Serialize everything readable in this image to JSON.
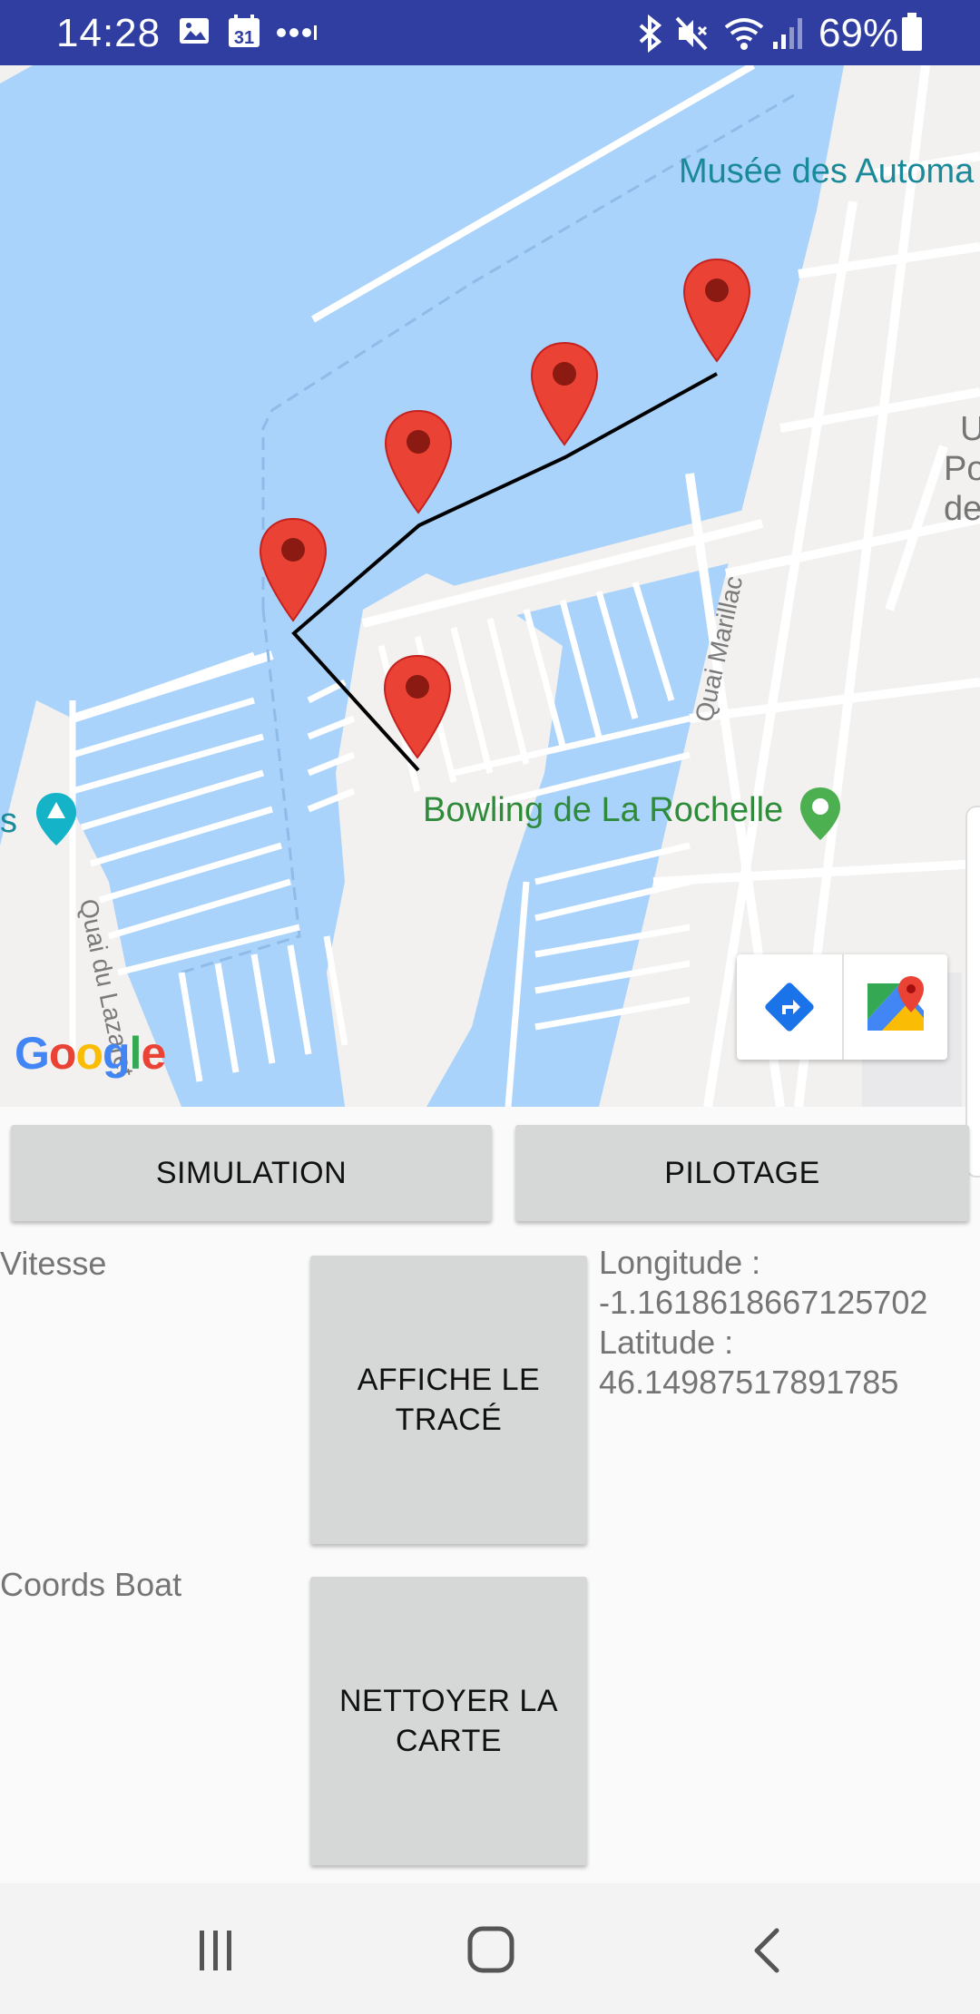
{
  "status_bar": {
    "time": "14:28",
    "calendar_day": "31",
    "battery": "69%",
    "icons": [
      "gallery-icon",
      "calendar-icon",
      "more-icon",
      "bluetooth-icon",
      "mute-icon",
      "wifi-icon",
      "signal-icon",
      "battery-icon"
    ]
  },
  "map": {
    "poi": {
      "museum": "Musée des Automa",
      "bowling": "Bowling de La Rochelle",
      "partial_right_1": "U",
      "partial_right_2": "Po",
      "partial_right_3": "de",
      "partial_left": "s"
    },
    "streets": {
      "quai_marillac": "Quai Marillac",
      "quai_lazaret": "Quai du Lazaret"
    },
    "logo": "Google",
    "colors": {
      "water": "#aad3fb",
      "land": "#f2f1ef",
      "marker": "#ea4335",
      "poi_green": "#2e8b3a",
      "poi_teal": "#1a8a9a"
    }
  },
  "buttons": {
    "simulation": "SIMULATION",
    "pilotage": "PILOTAGE",
    "affiche_line1": "AFFICHE LE",
    "affiche_line2": "TRACÉ",
    "nettoyer_line1": "NETTOYER LA",
    "nettoyer_line2": "CARTE"
  },
  "labels": {
    "vitesse": "Vitesse",
    "coords_boat": "Coords Boat"
  },
  "coordinates": {
    "longitude_label": "Longitude :",
    "longitude_value": "-1.1618618667125702",
    "latitude_label": "Latitude :",
    "latitude_value": "46.14987517891785"
  },
  "nav_bar": {
    "items": [
      "recent-apps-icon",
      "home-icon",
      "back-icon"
    ]
  }
}
